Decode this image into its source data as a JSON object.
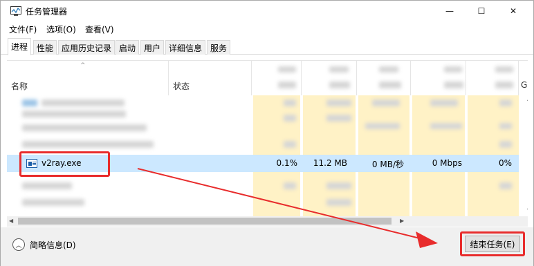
{
  "window": {
    "title": "任务管理器",
    "controls": {
      "minimize": "—",
      "maximize": "☐",
      "close": "✕"
    }
  },
  "menu": [
    "文件(F)",
    "选项(O)",
    "查看(V)"
  ],
  "tabs": [
    "进程",
    "性能",
    "应用历史记录",
    "启动",
    "用户",
    "详细信息",
    "服务"
  ],
  "active_tab": "进程",
  "columns": {
    "name": "名称",
    "status": "状态",
    "partial": "G"
  },
  "rows": [
    {
      "name": "v2ray.exe",
      "cpu": "0.1%",
      "memory": "11.2 MB",
      "disk": "0 MB/秒",
      "network": "0 Mbps",
      "gpu": "0%",
      "selected": true
    }
  ],
  "footer": {
    "fewer_details": "简略信息(D)",
    "end_task": "结束任务(E)"
  },
  "annotation_color": "#e82c2c",
  "selection_color": "#cce8ff",
  "highlight_color": "#fff2c6"
}
